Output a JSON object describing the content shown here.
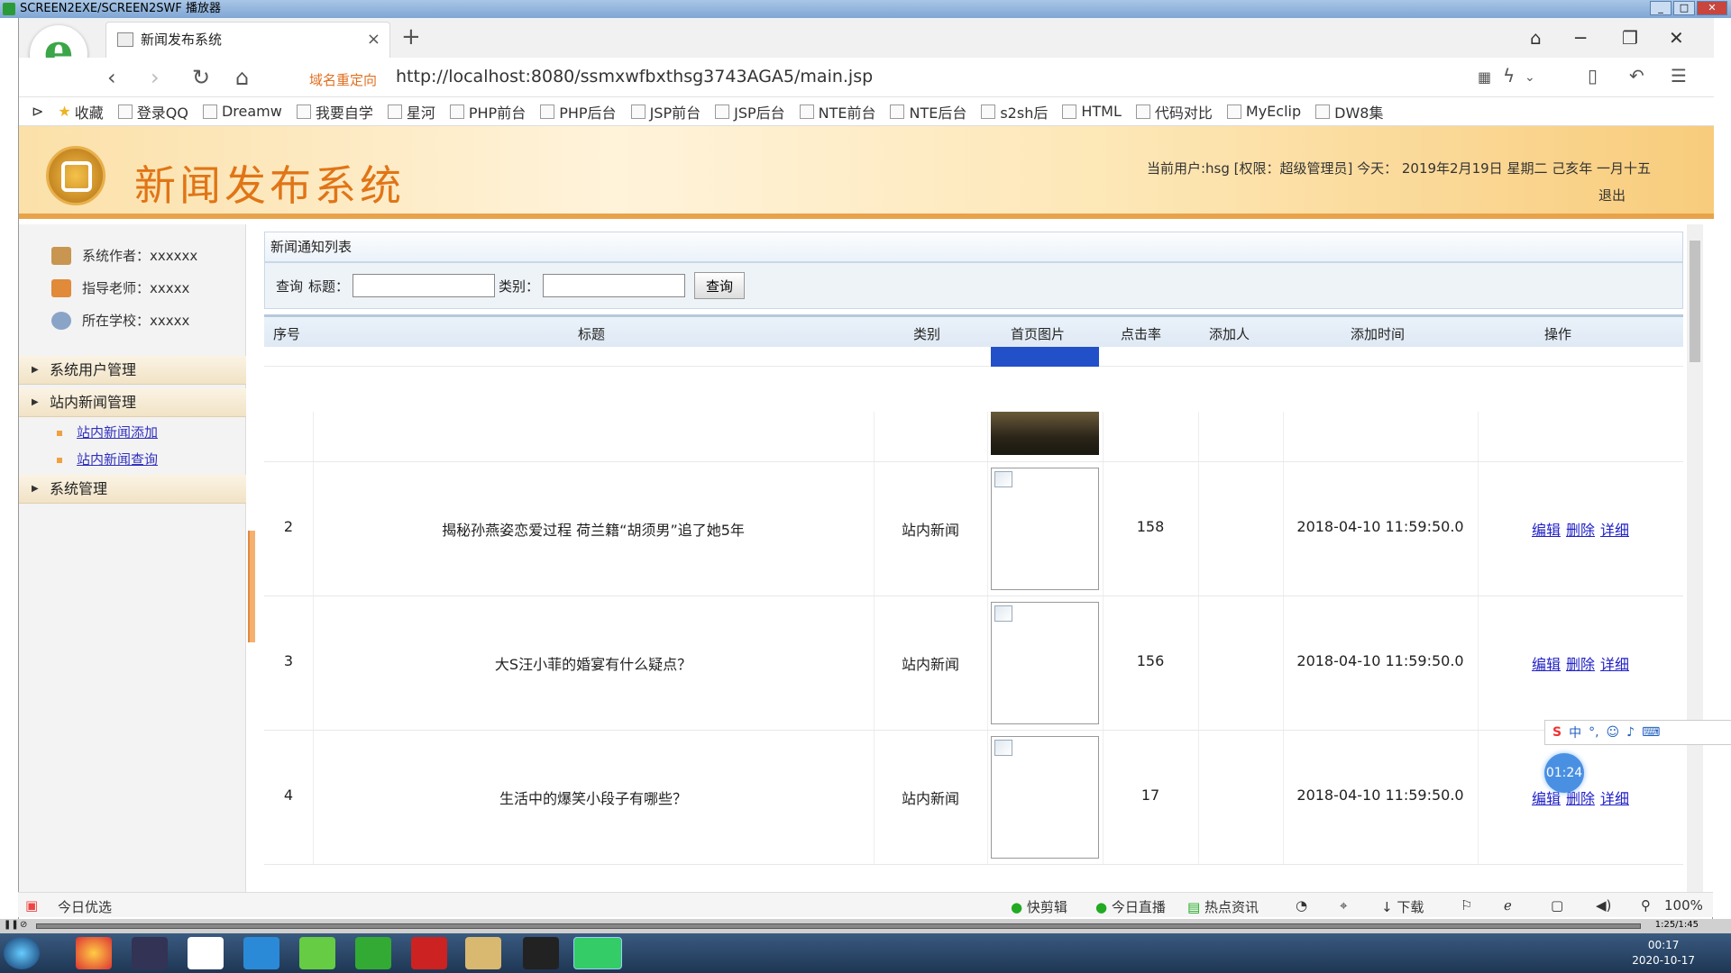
{
  "player": {
    "title": "SCREEN2EXE/SCREEN2SWF 播放器",
    "time": "1:25/1:45"
  },
  "browser": {
    "tab_title": "新闻发布系统",
    "redirect_label": "域名重定向",
    "url": "http://localhost:8080/ssmxwfbxthsg3743AGA5/main.jsp",
    "bookmarks": [
      "收藏",
      "登录QQ",
      "Dreamw",
      "我要自学",
      "星河",
      "PHP前台",
      "PHP后台",
      "JSP前台",
      "JSP后台",
      "NTE前台",
      "NTE后台",
      "s2sh后",
      "HTML",
      "代码对比",
      "MyEclip",
      "DW8集"
    ]
  },
  "header": {
    "title": "新闻发布系统",
    "user_info": "当前用户:hsg [权限：超级管理员] 今天： 2019年2月19日 星期二 己亥年 一月十五",
    "logout": "退出"
  },
  "sidebar": {
    "author": "系统作者：xxxxxx",
    "teacher": "指导老师：xxxxx",
    "school": "所在学校：xxxxx",
    "menus": [
      "系统用户管理",
      "站内新闻管理",
      "系统管理"
    ],
    "submenu": [
      "站内新闻添加",
      "站内新闻查询"
    ]
  },
  "content": {
    "panel_title": "新闻通知列表",
    "search_prefix": "查询",
    "title_label": "标题：",
    "category_label": "类别：",
    "search_button": "查询",
    "columns": [
      "序号",
      "标题",
      "类别",
      "首页图片",
      "点击率",
      "添加人",
      "添加时间",
      "操作"
    ],
    "rows": [
      {
        "no": "2",
        "title": "揭秘孙燕姿恋爱过程 荷兰籍“胡须男”追了她5年",
        "category": "站内新闻",
        "clicks": "158",
        "adder": "",
        "time": "2018-04-10 11:59:50.0"
      },
      {
        "no": "3",
        "title": "大S汪小菲的婚宴有什么疑点？",
        "category": "站内新闻",
        "clicks": "156",
        "adder": "",
        "time": "2018-04-10 11:59:50.0"
      },
      {
        "no": "4",
        "title": "生活中的爆笑小段子有哪些？",
        "category": "站内新闻",
        "clicks": "17",
        "adder": "",
        "time": "2018-04-10 11:59:50.0"
      }
    ],
    "ops": [
      "编辑",
      "删除",
      "详细"
    ]
  },
  "statusbar": {
    "left": "今日优选",
    "items": [
      "快剪辑",
      "今日直播",
      "热点资讯",
      "下载"
    ],
    "zoom": "100%"
  },
  "taskbar": {
    "time": "00:17",
    "date": "2020-10-17"
  },
  "timer": "01:24",
  "ime": "中"
}
